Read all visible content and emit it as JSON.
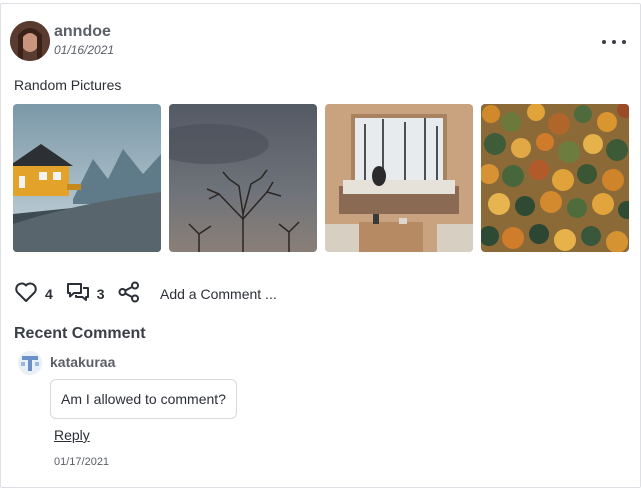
{
  "post": {
    "author": "anndoe",
    "date": "01/16/2021",
    "caption": "Random Pictures",
    "images": [
      "house-by-the-sea",
      "bare-tree-cloudy-sky",
      "cabin-window-reading",
      "autumn-forest"
    ]
  },
  "actions": {
    "likes": "4",
    "comments": "3",
    "add_comment": "Add a Comment ..."
  },
  "recent": {
    "title": "Recent Comment",
    "user": "katakuraa",
    "text": "Am I allowed to comment?",
    "reply": "Reply",
    "date": "01/17/2021"
  },
  "icons": [
    "heart-icon",
    "comment-icon",
    "share-icon",
    "more-icon"
  ],
  "colors": {
    "text": "#2b2f36",
    "muted": "#5b5f66",
    "border": "#dcdfe4"
  }
}
